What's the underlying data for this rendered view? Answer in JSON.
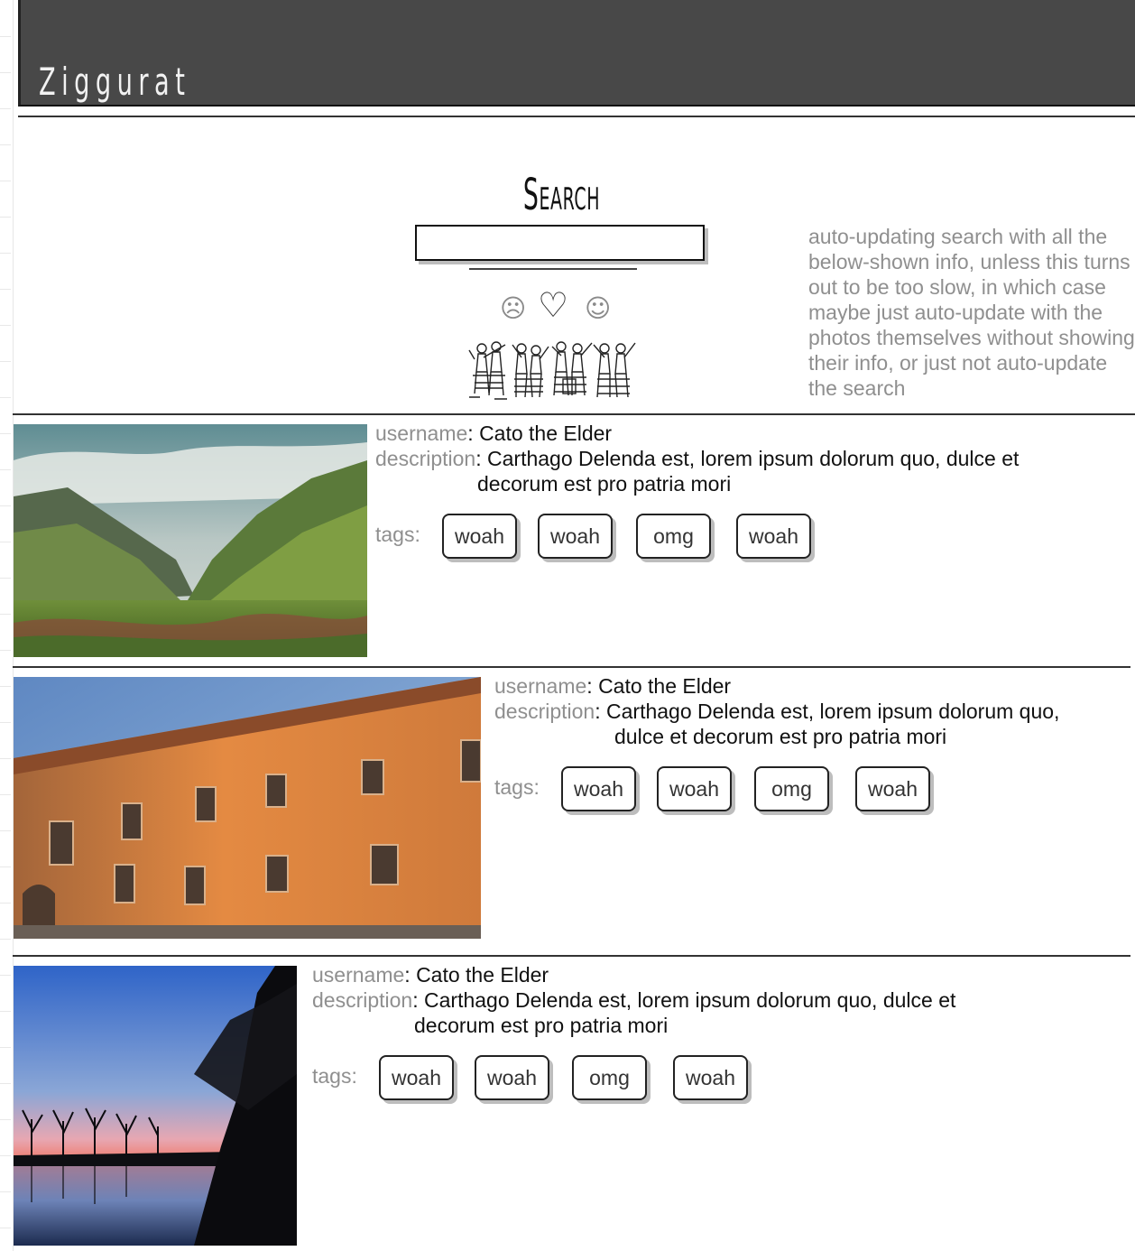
{
  "app": {
    "logo": "Ziggurat"
  },
  "search": {
    "title": "Search",
    "placeholder": "",
    "moods": {
      "sad": "☹",
      "love": "♡",
      "happy": "☺"
    },
    "note": "auto-updating search with all the below-shown info, unless this turns out to be too slow, in which case maybe just auto-update with the photos themselves without showing their info, or just not auto-update the search"
  },
  "labels": {
    "username": "username",
    "description": "description",
    "tags": "tags",
    "colon": ":"
  },
  "results": [
    {
      "username": "Cato the Elder",
      "description_line1": "Carthago Delenda est, lorem ipsum dolorum quo, dulce  et",
      "description_line2": "decorum est pro patria mori",
      "tags": [
        "woah",
        "woah",
        "omg",
        "woah"
      ],
      "image": "mountain-valley"
    },
    {
      "username": "Cato the Elder",
      "description_line1": "Carthago Delenda est, lorem ipsum dolorum quo,",
      "description_line2": "dulce  et decorum est pro patria mori",
      "tags": [
        "woah",
        "woah",
        "omg",
        "woah"
      ],
      "image": "brick-building"
    },
    {
      "username": "Cato the Elder",
      "description_line1": "Carthago Delenda est, lorem ipsum dolorum quo, dulce  et",
      "description_line2": "decorum est pro patria mori",
      "tags": [
        "woah",
        "woah",
        "omg",
        "woah"
      ],
      "image": "sunset-lake"
    }
  ]
}
